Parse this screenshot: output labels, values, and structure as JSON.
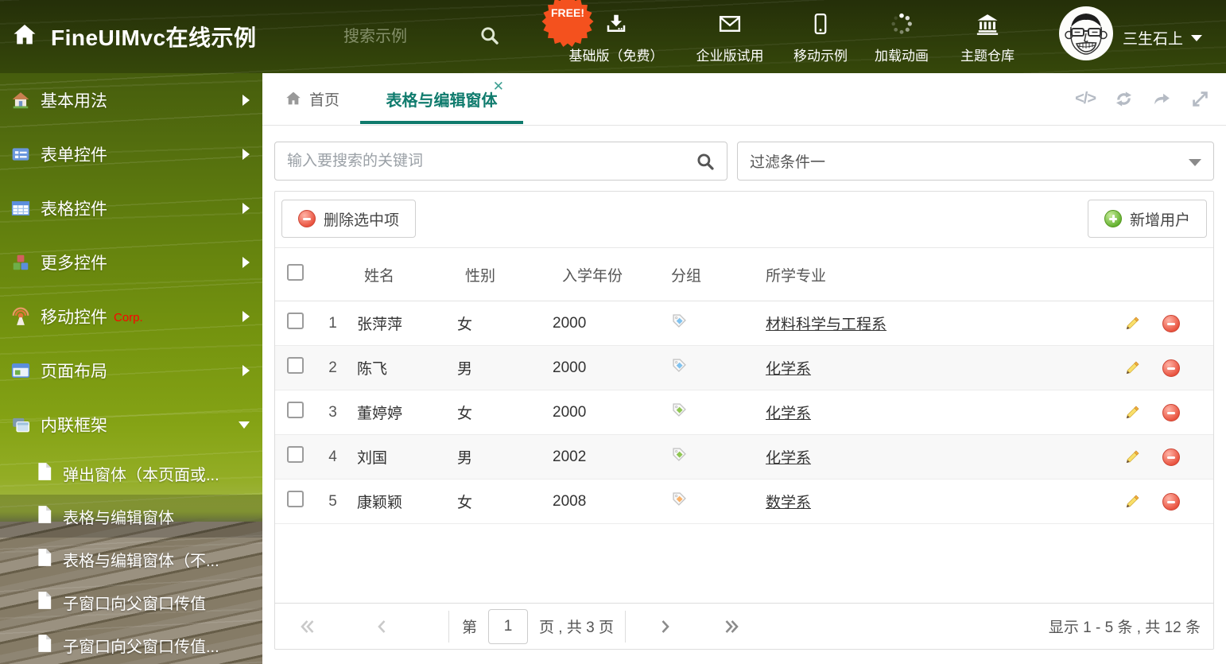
{
  "colors": {
    "accent_teal": "#0f7b6d",
    "free_orange": "#f4511e",
    "corp_red": "#ff0000",
    "tag_blue": "#81c2ee",
    "tag_green": "#8fc653",
    "tag_orange": "#f8b26a"
  },
  "header": {
    "title": "FineUIMvc在线示例",
    "search_placeholder": "搜索示例",
    "free_badge": "FREE!",
    "menu": [
      {
        "label": "基础版（免费）",
        "icon": "download-icon"
      },
      {
        "label": "企业版试用",
        "icon": "envelope-icon"
      },
      {
        "label": "移动示例",
        "icon": "mobile-icon"
      },
      {
        "label": "加载动画",
        "icon": "spinner-icon"
      },
      {
        "label": "主题仓库",
        "icon": "bank-icon"
      }
    ],
    "user_name": "三生石上"
  },
  "sidebar": {
    "items": [
      {
        "label": "基本用法",
        "icon": "home-icon"
      },
      {
        "label": "表单控件",
        "icon": "form-icon"
      },
      {
        "label": "表格控件",
        "icon": "table-icon"
      },
      {
        "label": "更多控件",
        "icon": "cubes-icon"
      },
      {
        "label": "移动控件",
        "badge": "Corp.",
        "icon": "antenna-icon"
      },
      {
        "label": "页面布局",
        "icon": "layout-icon"
      },
      {
        "label": "内联框架",
        "icon": "frames-icon",
        "expanded": true
      }
    ],
    "subitems": [
      {
        "label": "弹出窗体（本页面或..."
      },
      {
        "label": "表格与编辑窗体",
        "selected": true
      },
      {
        "label": "表格与编辑窗体（不..."
      },
      {
        "label": "子窗口向父窗口传值"
      },
      {
        "label": "子窗口向父窗口传值..."
      }
    ]
  },
  "tabs": {
    "home": "首页",
    "active": "表格与编辑窗体"
  },
  "filterbar": {
    "search_placeholder": "输入要搜索的关键词",
    "filter_selected": "过滤条件一"
  },
  "toolbar": {
    "delete_label": "删除选中项",
    "add_label": "新增用户"
  },
  "table": {
    "columns": [
      "姓名",
      "性别",
      "入学年份",
      "分组",
      "所学专业"
    ],
    "rows": [
      {
        "num": "1",
        "name": "张萍萍",
        "gender": "女",
        "year": "2000",
        "tag": "blue",
        "major": "材料科学与工程系"
      },
      {
        "num": "2",
        "name": "陈飞",
        "gender": "男",
        "year": "2000",
        "tag": "blue",
        "major": "化学系"
      },
      {
        "num": "3",
        "name": "董婷婷",
        "gender": "女",
        "year": "2000",
        "tag": "green",
        "major": "化学系"
      },
      {
        "num": "4",
        "name": "刘国",
        "gender": "男",
        "year": "2002",
        "tag": "green",
        "major": "化学系"
      },
      {
        "num": "5",
        "name": "康颖颖",
        "gender": "女",
        "year": "2008",
        "tag": "orange",
        "major": "数学系"
      }
    ]
  },
  "pagination": {
    "page_prefix": "第",
    "page_value": "1",
    "page_suffix": "页 , 共 3 页",
    "summary": "显示 1 - 5 条 , 共 12 条"
  }
}
